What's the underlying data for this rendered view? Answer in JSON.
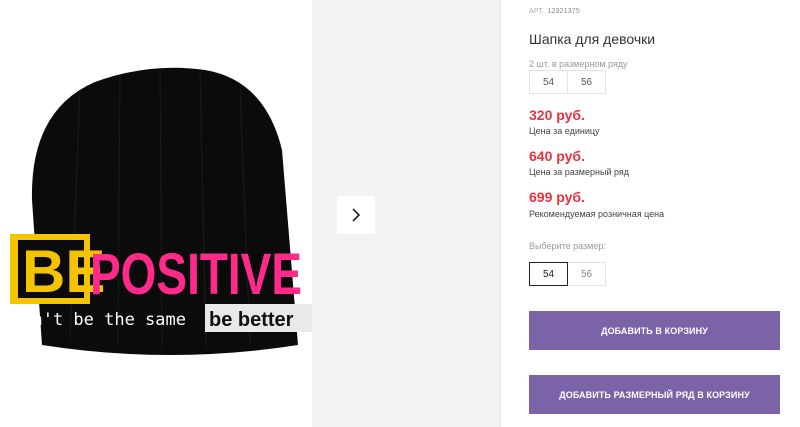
{
  "product": {
    "article_label": "АРТ.",
    "article_number": "12321375",
    "title": "Шапка для девочки",
    "image": {
      "print_be": "BE",
      "print_positive": "POSITIVE",
      "print_slogan": "don't be the same",
      "print_better": "be better"
    }
  },
  "size_row": {
    "note": "2 шт. в размерном ряду",
    "sizes": [
      "54",
      "56"
    ]
  },
  "prices": [
    {
      "value": "320 руб.",
      "note": "Цена за единицу"
    },
    {
      "value": "640 руб.",
      "note": "Цена за размерный ряд"
    },
    {
      "value": "699 руб.",
      "note": "Рекомендуемая розничная цена"
    }
  ],
  "size_select": {
    "label": "Выберите размер:",
    "options": [
      "54",
      "56"
    ],
    "selected": "54"
  },
  "buttons": {
    "add_to_cart": "Добавить в корзину",
    "add_row_to_cart": "Добавить размерный ряд в корзину"
  },
  "colors": {
    "price": "#e8323f",
    "button": "#7b63a8",
    "print_pink": "#ff2a8a",
    "print_yellow": "#f5c400"
  },
  "icons": {
    "next": "chevron-right-icon"
  }
}
